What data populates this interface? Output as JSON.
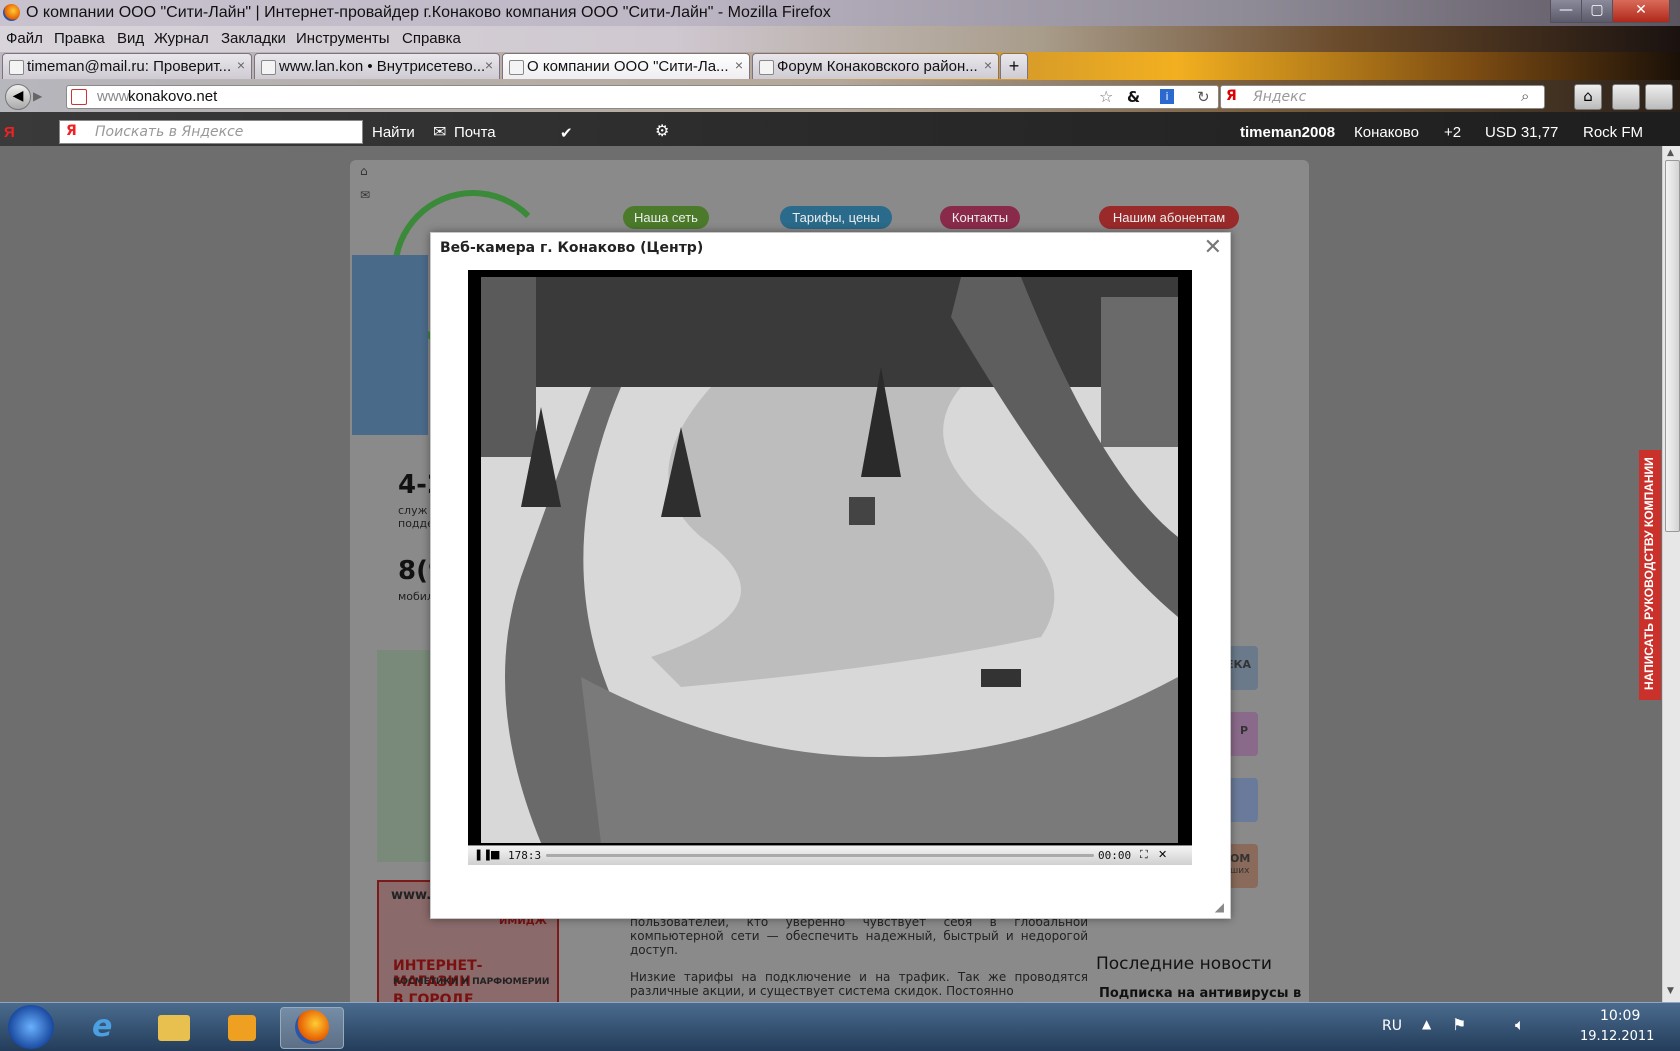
{
  "window": {
    "title": "О компании ООО \"Сити-Лайн\" | Интернет-провайдер г.Конаково компания ООО \"Сити-Лайн\" - Mozilla Firefox",
    "controls": {
      "minimize": "—",
      "maximize": "▢",
      "close": "✕"
    }
  },
  "menu": [
    "Файл",
    "Правка",
    "Вид",
    "Журнал",
    "Закладки",
    "Инструменты",
    "Справка"
  ],
  "tabs": [
    {
      "label": "timeman@mail.ru: Проверит...",
      "close": "×"
    },
    {
      "label": "www.lan.kon • Внутрисетево...",
      "close": "×"
    },
    {
      "label": "О компании ООО \"Сити-Ла...",
      "close": "×"
    },
    {
      "label": "Форум Конаковского район...",
      "close": "×"
    }
  ],
  "new_tab": "+",
  "nav": {
    "url_prefix": "www.",
    "url_domain": "konakovo.net",
    "search_placeholder": "Яндекс",
    "search_engine": "Я"
  },
  "yandex_bar": {
    "logo": "Я",
    "search_placeholder": "Поискать в Яндексе",
    "find": "Найти",
    "mail": "Почта",
    "user": "timeman2008",
    "city": "Конаково",
    "weather": "+2",
    "currency": "USD 31,77",
    "radio": "Rock FM"
  },
  "site": {
    "nav": [
      "Наша сеть",
      "Тарифы, цены",
      "Контакты",
      "Нашим абонентам"
    ],
    "phone1": "4-2",
    "phone1_sub1": "служ",
    "phone1_sub2": "подде",
    "phone2": "8(9",
    "phone2_sub": "мобил",
    "banner": {
      "url": "www.",
      "tag": "ИМИДЖ",
      "title": "ИНТЕРНЕТ-МАГАЗИН",
      "sub": "КОСМЕТИКИ И ПАРФЮМЕРИИ",
      "city": "В ГОРОДЕ КОНАКОВО"
    },
    "body_text": "пользователей, кто уверенно чувствует себя в глобальной компьютерной сети — обеспечить надежный, быстрый и недорогой доступ.",
    "body_text2": "Низкие тарифы на подключение и на трафик. Так же проводятся различные акции, и существует система скидок. Постоянно",
    "news_title": "Последние новости",
    "news_item": "Подписка на антивирусы в",
    "side_labels": [
      "ЕКА",
      "Р",
      "ОМ",
      "ших"
    ],
    "side_tab": "НАПИСАТЬ РУКОВОДСТВУ КОМПАНИИ"
  },
  "modal": {
    "title": "Веб-камера г. Конаково (Центр)",
    "close": "✕",
    "player": {
      "time_left": "178:3",
      "time_right": "00:00",
      "progress": 0.0
    }
  },
  "taskbar": {
    "lang": "RU",
    "time": "10:09",
    "date": "19.12.2011"
  }
}
